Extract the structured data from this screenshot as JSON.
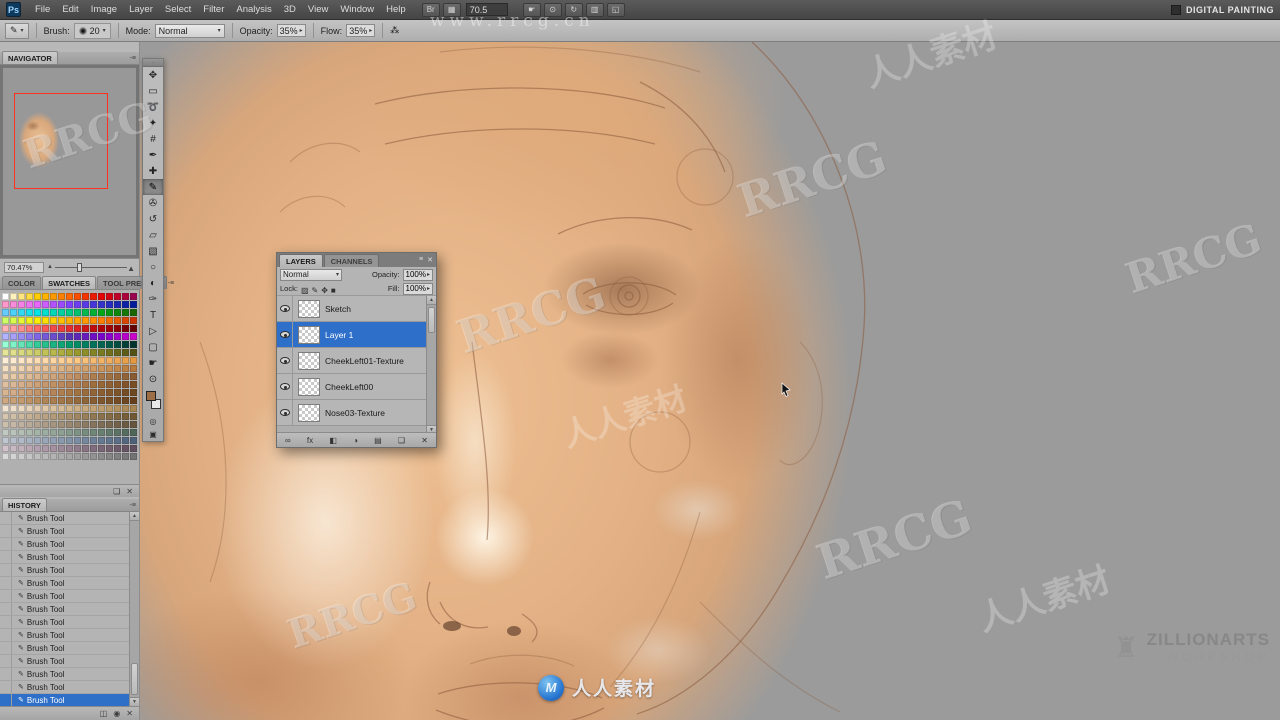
{
  "app": {
    "logo": "Ps",
    "menus": [
      "File",
      "Edit",
      "Image",
      "Layer",
      "Select",
      "Filter",
      "Analysis",
      "3D",
      "View",
      "Window",
      "Help"
    ],
    "appbar_left": [
      {
        "name": "bridge-launch-icon",
        "glyph": "Br"
      },
      {
        "name": "view-extras-icon",
        "glyph": "▦"
      }
    ],
    "zoom_field": "70.5",
    "appbar_right": [
      {
        "name": "hand-icon",
        "glyph": "☛"
      },
      {
        "name": "zoom-icon",
        "glyph": "⊙"
      },
      {
        "name": "rotate-view-icon",
        "glyph": "↻"
      },
      {
        "name": "arrange-documents-icon",
        "glyph": "▥"
      },
      {
        "name": "screen-mode-icon",
        "glyph": "◱"
      }
    ],
    "right_label": "DIGITAL PAINTING"
  },
  "options": {
    "brush_label": "Brush:",
    "brush_size": "20",
    "mode_label": "Mode:",
    "mode_value": "Normal",
    "opacity_label": "Opacity:",
    "opacity_value": "35%",
    "flow_label": "Flow:",
    "flow_value": "35%",
    "airbrush_glyph": "⁂"
  },
  "navigator": {
    "title": "NAVIGATOR",
    "zoom": "70.47%"
  },
  "swatches": {
    "tabs": [
      "COLOR",
      "SWATCHES",
      "TOOL PRESETS"
    ],
    "active_tab_index": 1,
    "footer_icons": [
      {
        "name": "new-swatch-icon",
        "glyph": "❏"
      },
      {
        "name": "delete-swatch-icon",
        "glyph": "✕"
      }
    ],
    "rows": [
      [
        "#ffffff",
        "#ffcc00",
        "#ff6600",
        "#e60000",
        "#99004d"
      ],
      [
        "#ff99cc",
        "#e666ff",
        "#8040ff",
        "#3333cc",
        "#001a99"
      ],
      [
        "#66ccff",
        "#00e6e6",
        "#00cc88",
        "#00a818",
        "#1a6600"
      ],
      [
        "#ccff66",
        "#ffee00",
        "#ffb300",
        "#ff8000",
        "#cc3300"
      ],
      [
        "#ffb3b3",
        "#ff6666",
        "#e62e2e",
        "#b30000",
        "#660000"
      ],
      [
        "#b3b3ff",
        "#8066e6",
        "#5533b3",
        "#7a00cc",
        "#cc00cc"
      ],
      [
        "#99ffd6",
        "#33cc99",
        "#00996b",
        "#006652",
        "#00332e"
      ],
      [
        "#e6e699",
        "#cccc66",
        "#a3a333",
        "#7a7a1f",
        "#525214"
      ],
      [
        "#ffefd9",
        "#ffddb3",
        "#ffcc8c",
        "#f2b366",
        "#e69940"
      ],
      [
        "#f5dfc2",
        "#ebc69e",
        "#dcad7a",
        "#cc9459",
        "#b87a3d"
      ],
      [
        "#ecd2b3",
        "#d9b48c",
        "#c49468",
        "#a87647",
        "#8a5c30"
      ],
      [
        "#e0c0a0",
        "#cda075",
        "#b58153",
        "#996636",
        "#7a4d24"
      ],
      [
        "#d9b592",
        "#c39468",
        "#a97847",
        "#8c5e30",
        "#6e471f"
      ],
      [
        "#cfa87f",
        "#b98c5c",
        "#9e7040",
        "#82572b",
        "#663f1a"
      ],
      [
        "#f2e4d2",
        "#e3cdb0",
        "#d2b68e",
        "#bf9e6e",
        "#a88652"
      ],
      [
        "#d6c6b0",
        "#bfa98c",
        "#a78d68",
        "#8c724b",
        "#705833"
      ],
      [
        "#cbbfae",
        "#b2a390",
        "#998871",
        "#7f6d55",
        "#66543d"
      ],
      [
        "#c2c9c2",
        "#a3b3a8",
        "#85998c",
        "#688071",
        "#4d6657"
      ],
      [
        "#bfc6cf",
        "#a0acbc",
        "#8293a8",
        "#667a93",
        "#4d617a"
      ],
      [
        "#cfc2cb",
        "#b3a0ae",
        "#968292",
        "#7a6677",
        "#604d5e"
      ],
      [
        "#d9d9d9",
        "#bfbfbf",
        "#a6a6a6",
        "#8c8c8c",
        "#737373"
      ]
    ]
  },
  "history": {
    "title": "HISTORY",
    "entries": [
      "Brush Tool",
      "Brush Tool",
      "Brush Tool",
      "Brush Tool",
      "Brush Tool",
      "Brush Tool",
      "Brush Tool",
      "Brush Tool",
      "Brush Tool",
      "Brush Tool",
      "Brush Tool",
      "Brush Tool",
      "Brush Tool",
      "Brush Tool",
      "Brush Tool"
    ],
    "selected_index": 14,
    "footer_icons": [
      {
        "name": "new-document-from-state-icon",
        "glyph": "◫"
      },
      {
        "name": "new-snapshot-icon",
        "glyph": "◉"
      },
      {
        "name": "delete-state-icon",
        "glyph": "✕"
      }
    ]
  },
  "tools": [
    {
      "name": "move-tool",
      "glyph": "✥"
    },
    {
      "name": "marquee-tool",
      "glyph": "▭"
    },
    {
      "name": "lasso-tool",
      "glyph": "➰"
    },
    {
      "name": "quick-selection-tool",
      "glyph": "✦"
    },
    {
      "name": "crop-tool",
      "glyph": "#"
    },
    {
      "name": "eyedropper-tool",
      "glyph": "✒"
    },
    {
      "name": "healing-brush-tool",
      "glyph": "✚"
    },
    {
      "name": "brush-tool",
      "glyph": "✎",
      "selected": true
    },
    {
      "name": "clone-stamp-tool",
      "glyph": "✇"
    },
    {
      "name": "history-brush-tool",
      "glyph": "↺"
    },
    {
      "name": "eraser-tool",
      "glyph": "▱"
    },
    {
      "name": "gradient-tool",
      "glyph": "▧"
    },
    {
      "name": "blur-tool",
      "glyph": "○"
    },
    {
      "name": "dodge-tool",
      "glyph": "◐"
    },
    {
      "name": "pen-tool",
      "glyph": "✑"
    },
    {
      "name": "type-tool",
      "glyph": "T"
    },
    {
      "name": "path-selection-tool",
      "glyph": "▷"
    },
    {
      "name": "shape-tool",
      "glyph": "▢"
    },
    {
      "name": "hand-tool",
      "glyph": "☛"
    },
    {
      "name": "zoom-tool",
      "glyph": "⊙"
    }
  ],
  "tool_colors": {
    "foreground": "#9c6e45",
    "background": "#e9e9e9"
  },
  "tool_buttons": [
    {
      "name": "quick-mask-icon",
      "glyph": "◎"
    },
    {
      "name": "screen-mode-button",
      "glyph": "▣"
    }
  ],
  "layers_panel": {
    "tabs": [
      "LAYERS",
      "CHANNELS"
    ],
    "blend_mode": "Normal",
    "opacity_label": "Opacity:",
    "opacity_value": "100%",
    "lock_label": "Lock:",
    "fill_label": "Fill:",
    "fill_value": "100%",
    "lock_icons": [
      {
        "name": "lock-transparency-icon",
        "glyph": "▨"
      },
      {
        "name": "lock-pixels-icon",
        "glyph": "✎"
      },
      {
        "name": "lock-position-icon",
        "glyph": "✥"
      },
      {
        "name": "lock-all-icon",
        "glyph": "■"
      }
    ],
    "layers": [
      {
        "name": "Sketch",
        "selected": false
      },
      {
        "name": "Layer 1",
        "selected": true
      },
      {
        "name": "CheekLeft01-Texture",
        "selected": false
      },
      {
        "name": "CheekLeft00",
        "selected": false
      },
      {
        "name": "Nose03-Texture",
        "selected": false
      }
    ],
    "bottom_icons": [
      {
        "name": "link-layers-icon",
        "glyph": "∞"
      },
      {
        "name": "layer-style-icon",
        "glyph": "fx"
      },
      {
        "name": "add-mask-icon",
        "glyph": "◧"
      },
      {
        "name": "adjustment-layer-icon",
        "glyph": "◑"
      },
      {
        "name": "layer-group-icon",
        "glyph": "▤"
      },
      {
        "name": "new-layer-icon",
        "glyph": "❏"
      },
      {
        "name": "delete-layer-icon",
        "glyph": "✕"
      }
    ]
  },
  "watermarks": {
    "url": "www.rrcg.cn",
    "brand_en": "RRCG",
    "brand_cn": "人人素材",
    "footer_brand": "人人素材",
    "footer_logo_letter": "M",
    "studio_line1": "ZILLIONARTS",
    "studio_line2": "WORKSHOP"
  }
}
